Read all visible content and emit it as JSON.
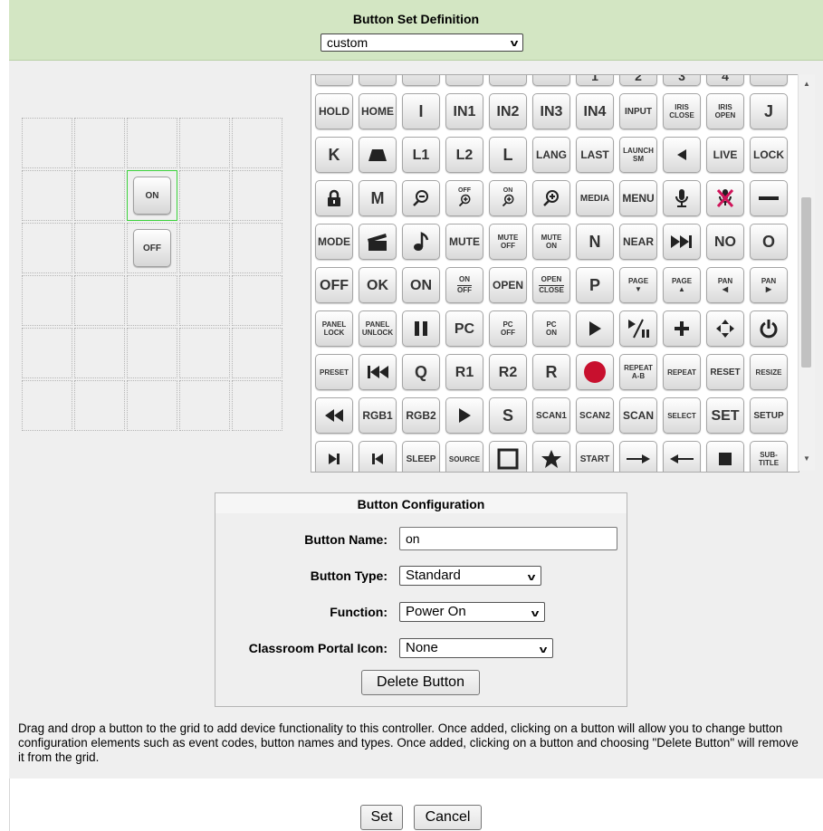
{
  "header": {
    "title": "Button Set Definition",
    "set_select": "custom"
  },
  "grid_buttons": {
    "on": "ON",
    "off": "OFF"
  },
  "palette": {
    "rows": [
      [
        {
          "t": "HOLD"
        },
        {
          "t": "HOME"
        },
        {
          "t": "I"
        },
        {
          "t": "IN1"
        },
        {
          "t": "IN2"
        },
        {
          "t": "IN3"
        },
        {
          "t": "IN4"
        },
        {
          "t": "INPUT"
        },
        {
          "t": "IRIS CLOSE"
        },
        {
          "t": "IRIS OPEN"
        },
        {
          "t": "J"
        }
      ],
      [
        {
          "t": "K"
        },
        {
          "t": "eject-icon"
        },
        {
          "t": "L1"
        },
        {
          "t": "L2"
        },
        {
          "t": "L"
        },
        {
          "t": "LANG"
        },
        {
          "t": "LAST"
        },
        {
          "t": "LAUNCH SM"
        },
        {
          "t": "left-arrow-icon"
        },
        {
          "t": "LIVE"
        },
        {
          "t": "LOCK"
        }
      ],
      [
        {
          "t": "lock-icon"
        },
        {
          "t": "M"
        },
        {
          "t": "zoom-out-icon"
        },
        {
          "t": "OFF zoom-in"
        },
        {
          "t": "ON zoom-in"
        },
        {
          "t": "zoom-in-icon"
        },
        {
          "t": "MEDIA"
        },
        {
          "t": "MENU"
        },
        {
          "t": "mic-icon"
        },
        {
          "t": "mic-mute-icon"
        },
        {
          "t": "minus-icon"
        }
      ],
      [
        {
          "t": "MODE"
        },
        {
          "t": "clapper-icon"
        },
        {
          "t": "music-icon"
        },
        {
          "t": "MUTE"
        },
        {
          "t": "MUTE OFF"
        },
        {
          "t": "MUTE ON"
        },
        {
          "t": "N"
        },
        {
          "t": "NEAR"
        },
        {
          "t": "next-track-icon"
        },
        {
          "t": "NO"
        },
        {
          "t": "O"
        }
      ],
      [
        {
          "t": "OFF"
        },
        {
          "t": "OK"
        },
        {
          "t": "ON"
        },
        {
          "t": "ON / OFF"
        },
        {
          "t": "OPEN"
        },
        {
          "t": "OPEN / CLOSE"
        },
        {
          "t": "P"
        },
        {
          "t": "PAGE ▼"
        },
        {
          "t": "PAGE ▲"
        },
        {
          "t": "PAN ◀"
        },
        {
          "t": "PAN ▶"
        }
      ],
      [
        {
          "t": "PANEL LOCK"
        },
        {
          "t": "PANEL UNLOCK"
        },
        {
          "t": "pause-icon"
        },
        {
          "t": "PC"
        },
        {
          "t": "PC OFF"
        },
        {
          "t": "PC ON"
        },
        {
          "t": "play-icon"
        },
        {
          "t": "play-pause-icon"
        },
        {
          "t": "plus-icon"
        },
        {
          "t": "move-icon"
        },
        {
          "t": "power-icon"
        }
      ],
      [
        {
          "t": "PRESET"
        },
        {
          "t": "prev-track-icon"
        },
        {
          "t": "Q"
        },
        {
          "t": "R1"
        },
        {
          "t": "R2"
        },
        {
          "t": "R"
        },
        {
          "t": "record-icon"
        },
        {
          "t": "REPEAT A-B"
        },
        {
          "t": "REPEAT"
        },
        {
          "t": "RESET"
        },
        {
          "t": "RESIZE"
        }
      ],
      [
        {
          "t": "rewind-icon"
        },
        {
          "t": "RGB1"
        },
        {
          "t": "RGB2"
        },
        {
          "t": "play-icon"
        },
        {
          "t": "S"
        },
        {
          "t": "SCAN1"
        },
        {
          "t": "SCAN2"
        },
        {
          "t": "SCAN"
        },
        {
          "t": "SELECT"
        },
        {
          "t": "SET"
        },
        {
          "t": "SETUP"
        }
      ],
      [
        {
          "t": "step-fwd-icon"
        },
        {
          "t": "step-back-icon"
        },
        {
          "t": "SLEEP"
        },
        {
          "t": "SOURCE"
        },
        {
          "t": "square-icon"
        },
        {
          "t": "star-icon"
        },
        {
          "t": "START"
        },
        {
          "t": "arrow-right-icon"
        },
        {
          "t": "arrow-left-icon"
        },
        {
          "t": "stop-icon"
        },
        {
          "t": "SUB-TITLE"
        }
      ]
    ],
    "top_partial": [
      "",
      "",
      "",
      "",
      "",
      "",
      "1",
      "2",
      "3",
      "4",
      ""
    ]
  },
  "config": {
    "heading": "Button Configuration",
    "name_label": "Button Name:",
    "name_value": "on",
    "type_label": "Button Type:",
    "type_value": "Standard",
    "function_label": "Function:",
    "function_value": "Power On",
    "portal_label": "Classroom Portal Icon:",
    "portal_value": "None",
    "delete_label": "Delete Button"
  },
  "help_text": "Drag and drop a button to the grid to add device functionality to this controller. Once added, clicking on a button will allow you to change button configuration elements such as event codes, button names and types. Once added, clicking on a button and choosing \"Delete Button\" will remove it from the grid.",
  "footer": {
    "set_label": "Set",
    "cancel_label": "Cancel"
  },
  "colors": {
    "header_bg": "#d3e6c3",
    "selected_border": "#3ad23a",
    "record": "#c8102e"
  }
}
